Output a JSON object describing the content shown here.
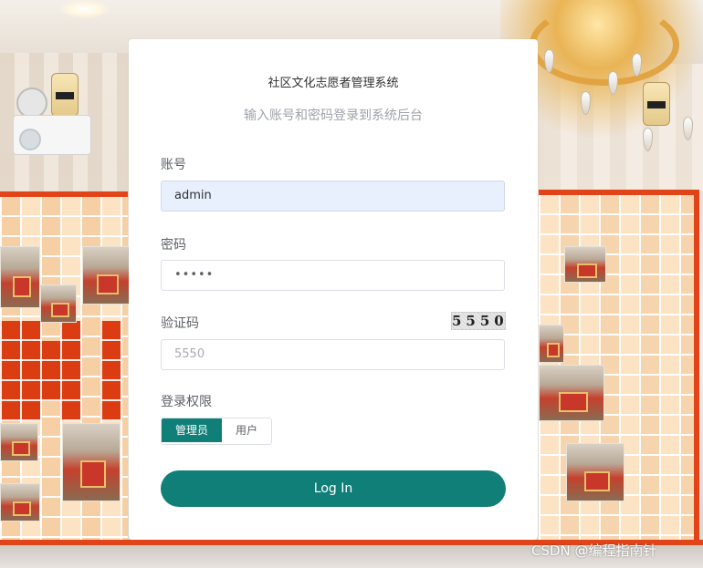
{
  "login": {
    "title": "社区文化志愿者管理系统",
    "subtitle": "输入账号和密码登录到系统后台",
    "account": {
      "label": "账号",
      "value": "admin"
    },
    "password": {
      "label": "密码",
      "masked_value": "•••••"
    },
    "captcha": {
      "label": "验证码",
      "image_text": "5550",
      "placeholder": "5550"
    },
    "role": {
      "label": "登录权限",
      "options": [
        "管理员",
        "用户"
      ],
      "selected": "管理员"
    },
    "submit_label": "Log In"
  },
  "watermark": "CSDN @编程指南针",
  "colors": {
    "primary": "#107f78",
    "autofill_bg": "#e8f0fe",
    "frame_red": "#e2441a"
  }
}
